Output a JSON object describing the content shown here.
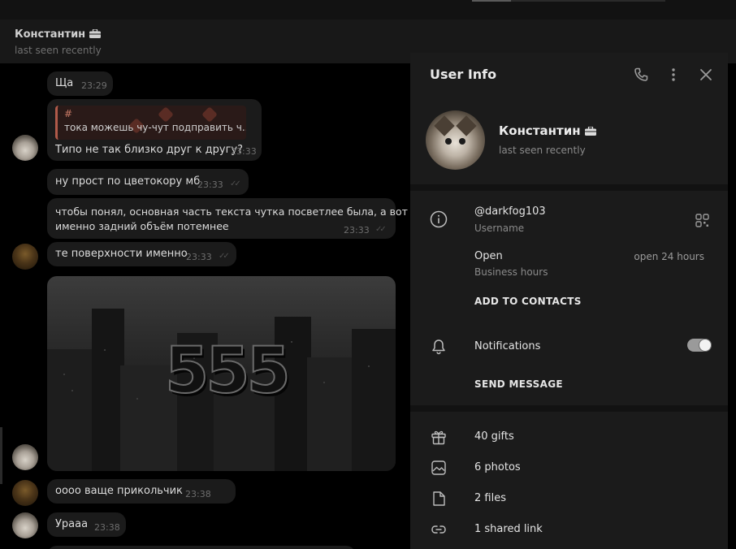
{
  "chat_header": {
    "name": "Константин",
    "status": "last seen recently"
  },
  "messages": [
    {
      "text": "Ща",
      "time": "23:29"
    },
    {
      "reply_tag": "#",
      "reply_text": "тока можешь чу-чут подправить ч...",
      "text": "Типо не так близко друг к другу?",
      "time": "23:33"
    },
    {
      "text": "ну прост по цветокору мб",
      "time": "23:33"
    },
    {
      "line1": "чтобы понял, основная часть текста чутка посветлее была, а вот",
      "line2": "именно задний объём потемнее",
      "time": "23:33"
    },
    {
      "text": "те поверхности именно",
      "time": "23:33"
    },
    {
      "image_text": "555"
    },
    {
      "text": "оооо ваще прикольчик",
      "time": "23:38"
    },
    {
      "text": "Урааа",
      "time": "23:38"
    }
  ],
  "panel": {
    "title": "User Info",
    "name": "Константин",
    "status": "last seen recently",
    "username": "@darkfog103",
    "username_label": "Username",
    "hours_primary": "Open",
    "hours_label": "Business hours",
    "hours_value": "open 24 hours",
    "add_contacts": "ADD TO CONTACTS",
    "notifications": "Notifications",
    "notifications_on": true,
    "send_message": "SEND MESSAGE",
    "gifts": "40 gifts",
    "photos": "6 photos",
    "files": "2 files",
    "links": "1 shared link"
  },
  "icons": {
    "header": [
      "phone-icon",
      "more-vertical-icon",
      "close-icon"
    ],
    "rows": [
      "info-icon",
      "qr-code-icon",
      "bell-icon",
      "gift-icon",
      "photo-icon",
      "file-icon",
      "link-icon",
      "briefcase-icon"
    ]
  }
}
